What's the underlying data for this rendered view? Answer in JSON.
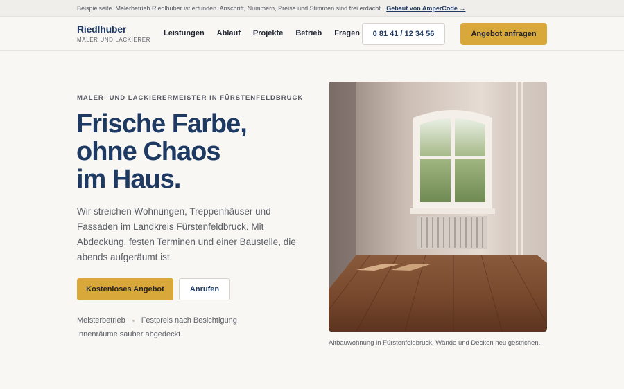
{
  "topbar": {
    "notice": "Beispielseite. Malerbetrieb Riedlhuber ist erfunden. Anschrift, Nummern, Preise und Stimmen sind frei erdacht.",
    "link": "Gebaut von AmperCode →"
  },
  "header": {
    "brand": "Riedlhuber",
    "brand_sub": "MALER UND LACKIERER",
    "nav": [
      "Leistungen",
      "Ablauf",
      "Projekte",
      "Betrieb",
      "Fragen"
    ],
    "phone": "0 81 41 / 12 34 56",
    "cta": "Angebot anfragen"
  },
  "hero": {
    "eyebrow": "MALER- UND LACKIERERMEISTER IN FÜRSTENFELDBRUCK",
    "headline": [
      "Frische Farbe,",
      "ohne Chaos",
      "im Haus."
    ],
    "lead": "Wir streichen Wohnungen, Treppenhäuser und Fassaden im Landkreis Fürstenfeldbruck. Mit Abdeckung, festen Terminen und einer Baustelle, die abends aufgeräumt ist.",
    "primary_button": "Kostenloses Angebot",
    "secondary_button": "Anrufen",
    "badges": [
      "Meisterbetrieb",
      "Festpreis nach Besichtigung",
      "Innenräume sauber abgedeckt"
    ],
    "photo_caption": "Altbauwohnung in Fürstenfeldbruck, Wände und Decken neu gestrichen."
  },
  "colors": {
    "brand_blue": "#1e3a63",
    "accent_gold": "#d9a83a",
    "background": "#f8f7f4"
  }
}
